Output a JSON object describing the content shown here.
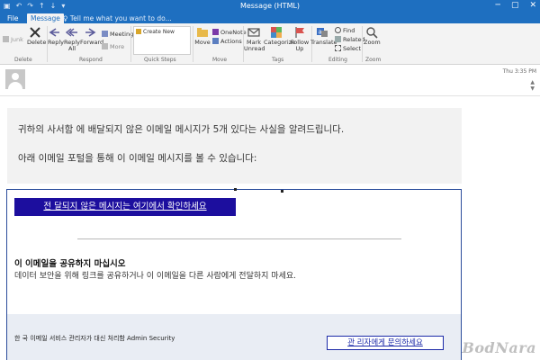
{
  "app": {
    "window_title": "Message (HTML)",
    "quick_access": [
      "save",
      "undo",
      "redo",
      "up",
      "down",
      "customize"
    ],
    "window_controls": {
      "minimize": "─",
      "restore": "▢",
      "close": "✕"
    }
  },
  "tabs": {
    "file": "File",
    "message": "Message",
    "tell_me": "Tell me what you want to do..."
  },
  "ribbon": {
    "junk": "Junk",
    "delete": "Delete",
    "reply": "Reply",
    "reply_all": "Reply All",
    "forward": "Forward",
    "meeting": "Meeting",
    "more": "More",
    "quick_steps_item": "Create New",
    "move": "Move",
    "onenote": "OneNote",
    "actions": "Actions",
    "mark_unread": "Mark Unread",
    "categorize": "Categorize",
    "follow_up": "Follow Up",
    "translate": "Translate",
    "find": "Find",
    "related": "Related",
    "select": "Select",
    "zoom": "Zoom",
    "groups": {
      "delete": "Delete",
      "respond": "Respond",
      "quick_steps": "Quick Steps",
      "move": "Move",
      "tags": "Tags",
      "editing": "Editing",
      "zoom": "Zoom"
    }
  },
  "header": {
    "timestamp": "Thu 3:35 PM"
  },
  "body": {
    "paragraph1": "귀하의 사서함 에 배달되지 않은 이메일 메시지가 5개 있다는 사실을 알려드립니다.",
    "paragraph2": "아래 이메일 포털을 통해 이 이메일 메시지를 볼 수 있습니다:",
    "link_button": "전 달되지 않은 메시지는 여기에서 확인하세요",
    "warning_title": "이 이메일을 공유하지 마십시오",
    "warning_text": "데이터 보안을 위해 링크를 공유하거나 이 이메일을 다른 사람에게 전달하지 마세요.",
    "footer_text": "한 국 이메일 서비스 관리자가 대신 처리함 Admin Security",
    "contact_button": "관 리자에게 문의하세요"
  },
  "watermark": "BodNara",
  "colors": {
    "titlebar": "#1e6fc0",
    "link_button_bg": "#1c0e9e",
    "content_border": "#2b4d9c",
    "footer_bg": "#e9edf4"
  }
}
